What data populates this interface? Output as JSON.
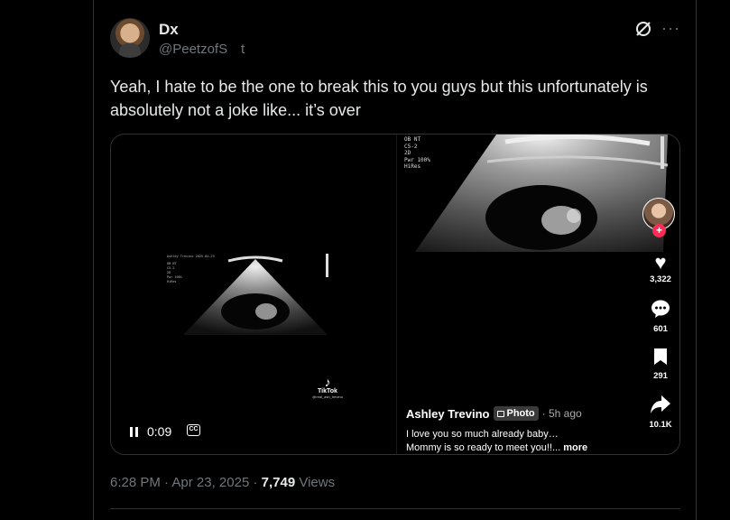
{
  "tweet": {
    "display_name": "Dx",
    "handle": "@PeetzofS",
    "handle_extra": "t",
    "text": "Yeah, I hate to be the one to break this to you guys but this unfortunately is absolutely not a joke like... it’s over",
    "time": "6:28 PM",
    "separator": "·",
    "date": "Apr 23, 2025",
    "views_count": "7,749",
    "views_label": "Views"
  },
  "icons": {
    "grok": "grok-icon",
    "more": "more-horizontal-icon",
    "pause": "pause-icon",
    "captions": "captions-icon",
    "like": "heart-icon",
    "comment": "comment-icon",
    "save": "bookmark-icon",
    "share": "share-icon"
  },
  "video": {
    "elapsed": "0:09",
    "cc_label": "CC",
    "small_scan_name": "Ashley Trevino     2025-04-23",
    "small_scan_meta": "OB NT\nC5-2\n2D\nPwr 100%\nHiRes",
    "tiktok_logo_text": "TikTok",
    "tiktok_username": "@real_ash_trevino"
  },
  "tiktok_post": {
    "scan_meta": "OB NT\nC5-2\n2D\nPwr 100%\nHiRes",
    "likes": "3,322",
    "comments": "601",
    "saves": "291",
    "shares": "10.1K",
    "follow_plus": "+",
    "author": "Ashley Trevino",
    "badge": "Photo",
    "age": "· 5h ago",
    "caption_line1": "I love you so much already baby…",
    "caption_line2": "Mommy is so ready to meet you!!...",
    "more": "more"
  },
  "colors": {
    "background": "#000000",
    "text": "#e7e9ea",
    "muted": "#71767b",
    "border": "#2f3336",
    "tiktok_red": "#fe2c55"
  }
}
